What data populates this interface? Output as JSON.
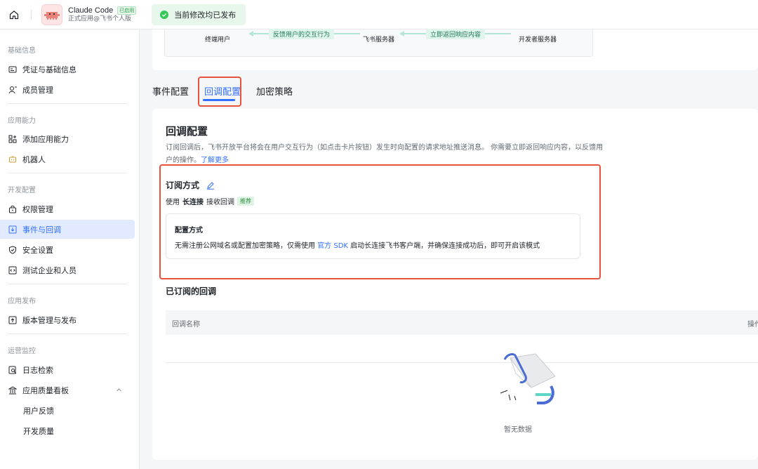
{
  "topbar": {
    "app_name": "Claude Code",
    "app_badge": "已启用",
    "app_sub": "正式应用@飞书个人版",
    "toast": "当前修改均已发布"
  },
  "sidebar": {
    "groups": [
      {
        "label": "基础信息"
      },
      {
        "label": "应用能力"
      },
      {
        "label": "开发配置"
      },
      {
        "label": "应用发布"
      },
      {
        "label": "运营监控"
      }
    ],
    "items": [
      {
        "label": "凭证与基础信息"
      },
      {
        "label": "成员管理"
      },
      {
        "label": "添加应用能力"
      },
      {
        "label": "机器人"
      },
      {
        "label": "权限管理"
      },
      {
        "label": "事件与回调"
      },
      {
        "label": "安全设置"
      },
      {
        "label": "测试企业和人员"
      },
      {
        "label": "版本管理与发布"
      },
      {
        "label": "日志检索"
      },
      {
        "label": "应用质量看板"
      },
      {
        "label": "用户反馈"
      },
      {
        "label": "开发质量"
      }
    ]
  },
  "flow": {
    "node_user": "终端用户",
    "node_feishu": "飞书服务器",
    "node_dev": "开发者服务器",
    "label_feedback": "反馈用户的交互行为",
    "label_return": "立即返回响应内容"
  },
  "tabs": [
    {
      "label": "事件配置"
    },
    {
      "label": "回调配置"
    },
    {
      "label": "加密策略"
    }
  ],
  "main": {
    "title": "回调配置",
    "desc": "订阅回调后，飞书开放平台将会在用户交互行为（如点击卡片按钮）发生时向配置的请求地址推送消息。 你需要立即返回响应内容，以反馈用户的操作。",
    "learn_more": "了解更多",
    "subscribe_title": "订阅方式",
    "mode_prefix": "使用",
    "mode_name": "长连接",
    "mode_suffix": "接收回调",
    "mode_tag": "推荐",
    "config_title": "配置方式",
    "config_text_1": "无需注册公网域名或配置加密策略，仅需使用",
    "config_link": "官方 SDK",
    "config_text_2": "启动长连接飞书客户端，并确保连接成功后，即可开启该模式",
    "subscribed_title": "已订阅的回调",
    "col_name": "回调名称",
    "col_op": "操作",
    "empty": "暂无数据"
  },
  "colors": {
    "accent": "#3370ff",
    "highlight": "#e5533d"
  }
}
